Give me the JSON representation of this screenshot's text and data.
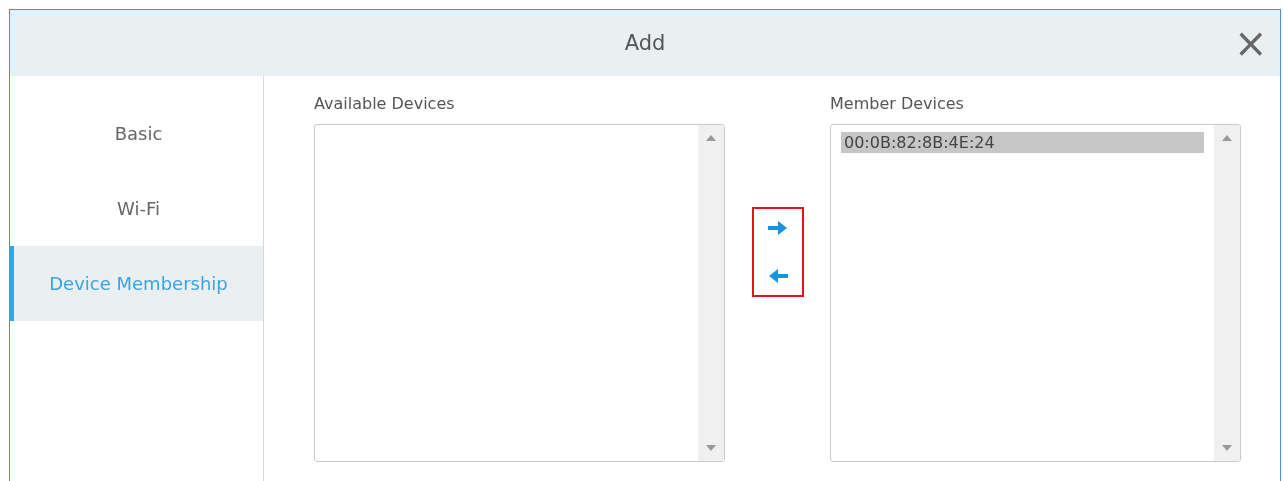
{
  "dialog": {
    "title": "Add",
    "close_symbol": "×"
  },
  "tabs": [
    {
      "label": "Basic",
      "selected": false
    },
    {
      "label": "Wi-Fi",
      "selected": false
    },
    {
      "label": "Device Membership",
      "selected": true
    }
  ],
  "available_devices": {
    "label": "Available Devices"
  },
  "transfer_buttons": [
    {
      "kind": "right"
    },
    {
      "kind": "left"
    }
  ],
  "member_devices": {
    "label": "Member Devices",
    "items": [
      {
        "label": "00:0B:82:8B:4E:24",
        "selected": true
      }
    ]
  }
}
